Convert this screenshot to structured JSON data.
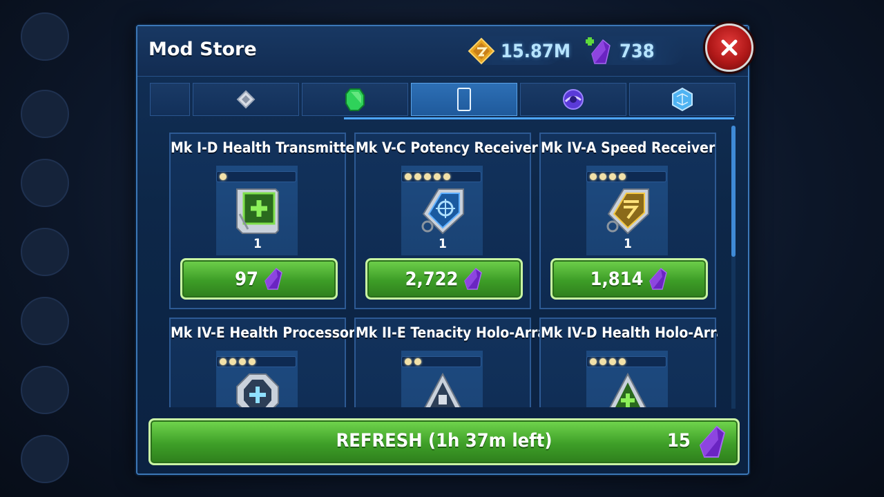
{
  "header": {
    "title": "Mod Store",
    "credits": "15.87M",
    "crystals": "738"
  },
  "tabs": [
    {
      "name": "tab-blank",
      "icon": "none",
      "active": false
    },
    {
      "name": "tab-square",
      "icon": "square-mod-icon",
      "active": false
    },
    {
      "name": "tab-diamond",
      "icon": "diamond-mod-icon",
      "active": false
    },
    {
      "name": "tab-circle",
      "icon": "circle-mod-icon",
      "active": true
    },
    {
      "name": "tab-arrow",
      "icon": "arrow-mod-icon",
      "active": false
    },
    {
      "name": "tab-triangle",
      "icon": "triangle-mod-icon",
      "active": false
    }
  ],
  "items": [
    {
      "title": "Mk I-D Health Transmitter",
      "stars": 1,
      "qty": "1",
      "price": "97",
      "icon": "health-transmitter-icon"
    },
    {
      "title": "Mk V-C Potency Receiver",
      "stars": 5,
      "qty": "1",
      "price": "2,722",
      "icon": "potency-receiver-icon"
    },
    {
      "title": "Mk IV-A Speed Receiver",
      "stars": 4,
      "qty": "1",
      "price": "1,814",
      "icon": "speed-receiver-icon"
    },
    {
      "title": "Mk IV-E Health Processor",
      "stars": 4,
      "qty": "",
      "price": "",
      "icon": "health-processor-icon"
    },
    {
      "title": "Mk II-E Tenacity Holo-Array",
      "stars": 2,
      "qty": "",
      "price": "",
      "icon": "tenacity-holo-array-icon"
    },
    {
      "title": "Mk IV-D Health Holo-Array",
      "stars": 4,
      "qty": "",
      "price": "",
      "icon": "health-holo-array-icon"
    }
  ],
  "refresh": {
    "label": "REFRESH (1h 37m left)",
    "cost": "15"
  },
  "colors": {
    "accent_green": "#4fb632",
    "crystal_purple": "#7a2fd0",
    "panel_blue": "#0e2a50",
    "close_red": "#c62020"
  }
}
